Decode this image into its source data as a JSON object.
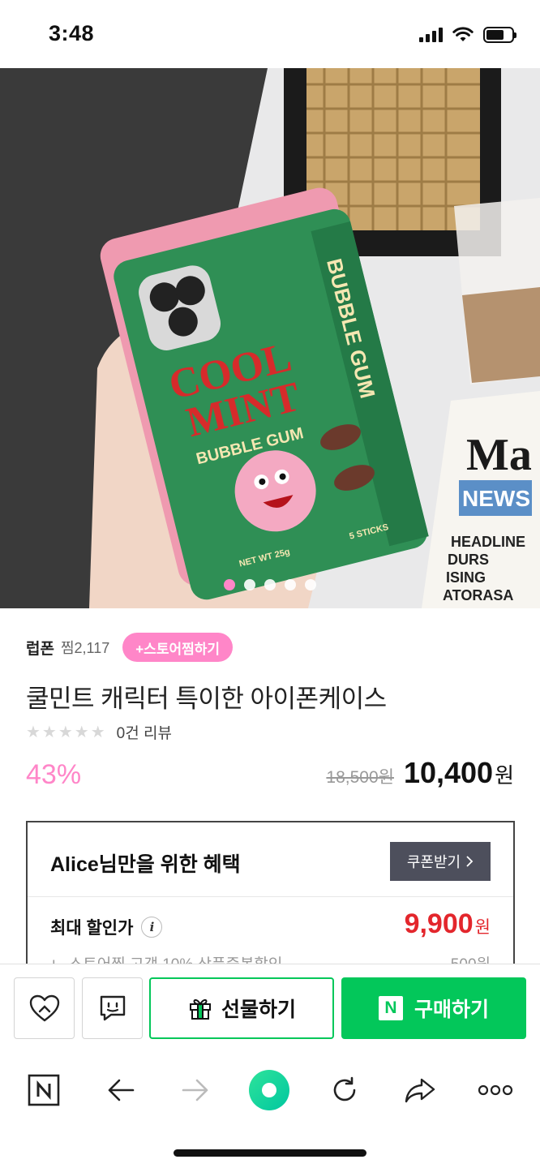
{
  "status_bar": {
    "time": "3:48"
  },
  "hero": {
    "image_count": 5,
    "active_index": 0,
    "brand_colors": {
      "dot_active": "#ff86c8"
    }
  },
  "store": {
    "name": "럽폰",
    "zzim_count": "찜2,117",
    "zzim_button": "+스토어찜하기"
  },
  "product": {
    "title": "쿨민트 캐릭터 특이한 아이폰케이스",
    "rating_stars": "★★★★★",
    "review_count": "0건 리뷰",
    "discount_rate": "43%",
    "original_price": "18,500원",
    "sale_price": "10,400",
    "currency": "원"
  },
  "benefit": {
    "title": "Alice님만을 위한 혜택",
    "coupon_button": "쿠폰받기",
    "max_label": "최대 할인가",
    "max_price": "9,900",
    "currency": "원",
    "sub_label": "ㄴ 스토어찜 고객 10% 상품중복할인",
    "sub_amount": "-500원"
  },
  "actions": {
    "gift_label": "선물하기",
    "buy_label": "구매하기",
    "buy_badge": "N"
  },
  "colors": {
    "naver_green": "#03c75a",
    "pink": "#ff86c8",
    "red": "#e3262c"
  }
}
